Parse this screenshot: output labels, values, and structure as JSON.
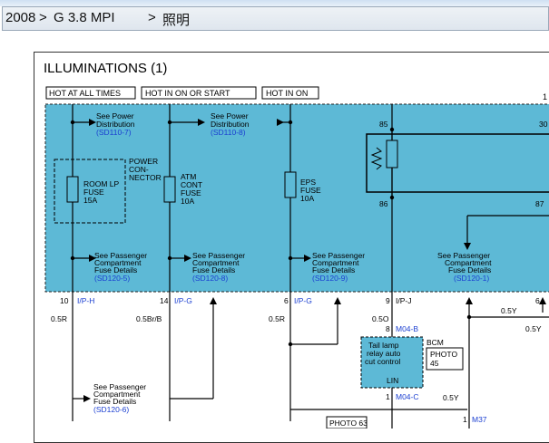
{
  "breadcrumb": {
    "year": "2008",
    "sep1": ">",
    "engine": "G 3.8 MPI",
    "sep2": ">",
    "section": "照明"
  },
  "diagram": {
    "title": "ILLUMINATIONS (1)",
    "power_labels": [
      "HOT AT ALL TIMES",
      "HOT IN ON OR START",
      "HOT IN ON"
    ],
    "page_marker": "1",
    "see_power_1": [
      "See Power",
      "Distribution",
      "(SD110-7)"
    ],
    "see_power_2": [
      "See Power",
      "Distribution",
      "(SD110-8)"
    ],
    "power_connector": [
      "POWER",
      "CON-",
      "NECTOR"
    ],
    "room_fuse": [
      "ROOM LP",
      "FUSE",
      "15A"
    ],
    "atm_fuse": [
      "ATM",
      "CONT",
      "FUSE",
      "10A"
    ],
    "eps_fuse": [
      "EPS",
      "FUSE",
      "10A"
    ],
    "relay_pins": [
      "85",
      "30",
      "86",
      "87"
    ],
    "pass_fuse_1": [
      "See Passenger",
      "Compartment",
      "Fuse Details",
      "(SD120-5)"
    ],
    "pass_fuse_2": [
      "See Passenger",
      "Compartment",
      "Fuse Details",
      "(SD120-8)"
    ],
    "pass_fuse_3": [
      "See Passenger",
      "Compartment",
      "Fuse Details",
      "(SD120-9)"
    ],
    "pass_fuse_4": [
      "See Passenger",
      "Compartment",
      "Fuse Details",
      "(SD120-1)"
    ],
    "pass_fuse_5": [
      "See Passenger",
      "Compartment",
      "Fuse Details",
      "(SD120-6)"
    ],
    "pin_10": "10",
    "conn_ip_h": "I/P-H",
    "pin_14": "14",
    "conn_ip_g1": "I/P-G",
    "pin_6a": "6",
    "conn_ip_g2": "I/P-G",
    "pin_9": "9",
    "conn_ip_j": "I/P-J",
    "pin_6b": "6",
    "wire_05r_1": "0.5R",
    "wire_05brb": "0.5Br/B",
    "wire_05r_2": "0.5R",
    "wire_05o": "0.5O",
    "wire_05y_1": "0.5Y",
    "wire_05y_2": "0.5Y",
    "wire_05y_3": "0.5Y",
    "pin_8": "8",
    "conn_m04b": "M04-B",
    "bcm_box": [
      "Tail lamp",
      "relay auto",
      "cut control"
    ],
    "bcm_label": "BCM",
    "photo_45": [
      "PHOTO",
      "45"
    ],
    "lin": "LIN",
    "pin_1a": "1",
    "conn_m04c": "M04-C",
    "pin_1b": "1",
    "conn_m37": "M37",
    "photo_63": "PHOTO 63"
  },
  "colors": {
    "zone": "#5db9d6",
    "link": "#1b3fd1",
    "wire": "#000000"
  }
}
